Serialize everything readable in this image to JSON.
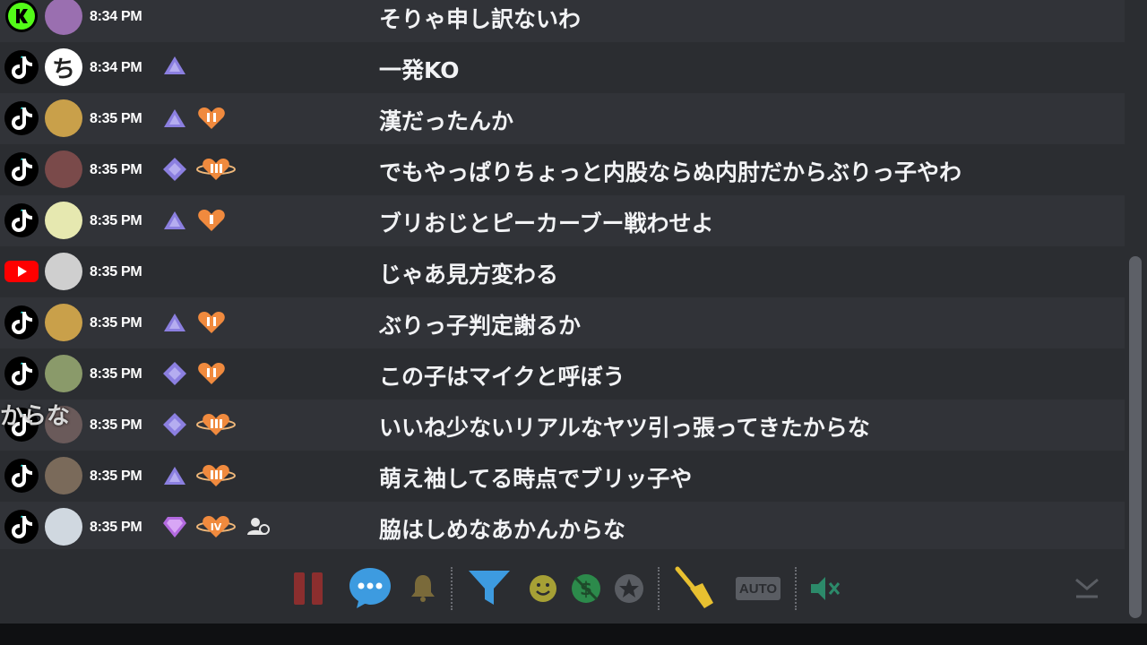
{
  "messages": [
    {
      "platform": "kick",
      "avatar": "user-avatar",
      "time": "8:34 PM",
      "badges": [],
      "text": "そりゃ申し訳ないわ"
    },
    {
      "platform": "tiktok",
      "avatar": "letter-avatar",
      "avatar_char": "ち",
      "time": "8:34 PM",
      "badges": [
        "triangle"
      ],
      "text": "一発KO"
    },
    {
      "platform": "tiktok",
      "avatar": "user-avatar",
      "time": "8:35 PM",
      "badges": [
        "triangle",
        "heart-2"
      ],
      "text": "漢だったんか"
    },
    {
      "platform": "tiktok",
      "avatar": "user-avatar",
      "time": "8:35 PM",
      "badges": [
        "diamond",
        "heart-3"
      ],
      "text": "でもやっぱりちょっと内股ならぬ内肘だからぶりっ子やわ"
    },
    {
      "platform": "tiktok",
      "avatar": "user-avatar",
      "time": "8:35 PM",
      "badges": [
        "triangle",
        "heart-1"
      ],
      "text": "ブリおじとピーカーブー戦わせよ"
    },
    {
      "platform": "youtube",
      "avatar": "user-avatar",
      "time": "8:35 PM",
      "badges": [],
      "text": "じゃあ見方変わる"
    },
    {
      "platform": "tiktok",
      "avatar": "user-avatar",
      "time": "8:35 PM",
      "badges": [
        "triangle",
        "heart-2"
      ],
      "text": "ぶりっ子判定謝るか"
    },
    {
      "platform": "tiktok",
      "avatar": "user-avatar",
      "time": "8:35 PM",
      "badges": [
        "diamond",
        "heart-2"
      ],
      "text": "この子はマイクと呼ぼう"
    },
    {
      "platform": "tiktok",
      "avatar": "user-avatar",
      "time": "8:35 PM",
      "badges": [
        "diamond",
        "heart-3"
      ],
      "text": "いいね少ないリアルなヤツ引っ張ってきたからな"
    },
    {
      "platform": "tiktok",
      "avatar": "user-avatar",
      "time": "8:35 PM",
      "badges": [
        "triangle",
        "heart-3"
      ],
      "text": "萌え袖してる時点でブリッ子や"
    },
    {
      "platform": "tiktok",
      "avatar": "user-avatar",
      "time": "8:35 PM",
      "badges": [
        "gem",
        "heart-4",
        "user-group"
      ],
      "text": "脇はしめなあかんからな"
    }
  ],
  "overlay_text": "からな",
  "toolbar": {
    "auto_label": "AUTO"
  },
  "colors": {
    "row_dark": "#2b2d31",
    "row_light": "#313338",
    "pause": "#8b2e2e",
    "chat_blue": "#3d9be0",
    "bell": "#7a6a3a",
    "filter": "#3d9be0",
    "emoji": "#a6a035",
    "crypto": "#2c8a4b",
    "broom": "#e8c030",
    "mute": "#2c8a6a"
  }
}
